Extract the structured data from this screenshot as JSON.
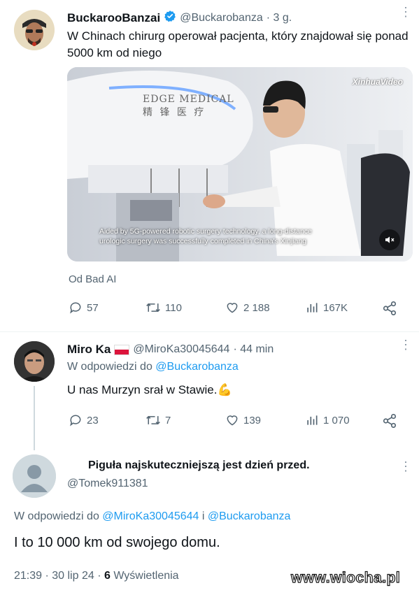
{
  "tweet1": {
    "name": "BuckarooBanzai",
    "handle": "@Buckarobanza",
    "sep_time": "· 3 g.",
    "text": "W Chinach chirurg operował pacjenta, który znajdował się ponad 5000 km od niego",
    "media": {
      "brand_line1": "EDGE MEDICAL",
      "brand_line2": "精 锋 医 疗",
      "watermark": "XinhuaVideo",
      "caption_line1": "Aided by 5G-powered robotic surgery technology, a long-distance",
      "caption_line2": "urologic surgery was successfully completed in China's Xinjiang"
    },
    "source": "Od Bad AI",
    "replies": "57",
    "retweets": "110",
    "likes": "2 188",
    "views": "167K"
  },
  "tweet2": {
    "name": "Miro Ka",
    "flag": "🇵🇱",
    "handle": "@MiroKa30045644",
    "sep_time": "· 44 min",
    "reply_prefix": "W odpowiedzi do",
    "reply_to": "@Buckarobanza",
    "text": "U nas Murzyn srał w Stawie.",
    "emoji": "💪",
    "replies": "23",
    "retweets": "7",
    "likes": "139",
    "views": "1 070"
  },
  "tweet3": {
    "name": "Piguła najskuteczniejszą jest dzień przed.",
    "handle": "@Tomek911381",
    "reply_prefix": "W odpowiedzi do",
    "reply_to1": "@MiroKa30045644",
    "reply_and": "i",
    "reply_to2": "@Buckarobanza",
    "text": "I to 10 000 km od swojego domu.",
    "time_date": "21:39 · 30 lip 24 ·",
    "views_count": "6",
    "views_label": "Wyświetlenia"
  },
  "site_watermark": "www.wiocha.pl",
  "colors": {
    "link": "#1d9bf0",
    "verified": "#1d9bf0",
    "muted": "#536471"
  }
}
